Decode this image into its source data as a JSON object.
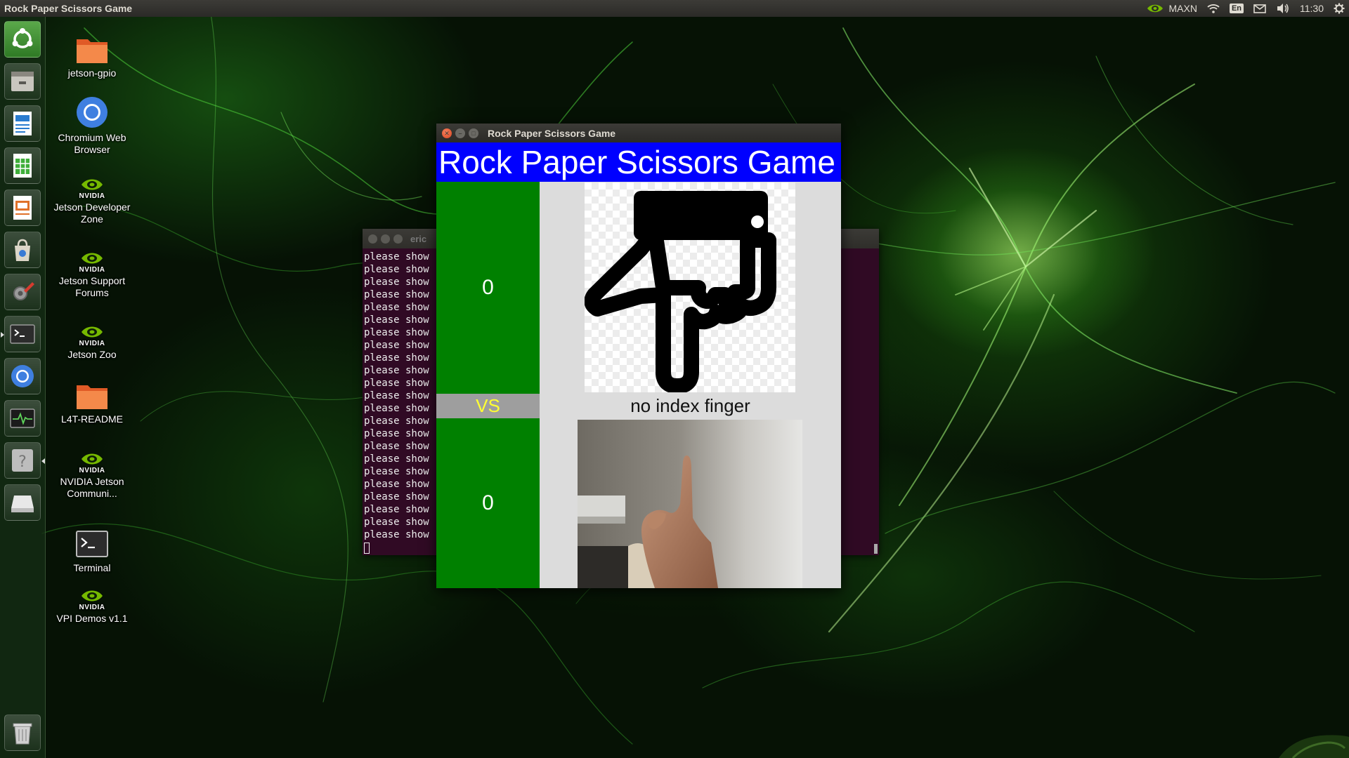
{
  "top_panel": {
    "window_title": "Rock Paper Scissors Game",
    "power_mode": "MAXN",
    "keyboard_layout": "En",
    "clock": "11:30"
  },
  "launcher": {
    "items": [
      {
        "name": "ubuntu-dash-icon"
      },
      {
        "name": "files-icon"
      },
      {
        "name": "libreoffice-writer-icon"
      },
      {
        "name": "libreoffice-calc-icon"
      },
      {
        "name": "libreoffice-impress-icon"
      },
      {
        "name": "software-center-icon"
      },
      {
        "name": "system-settings-icon"
      },
      {
        "name": "terminal-icon"
      },
      {
        "name": "chromium-icon"
      },
      {
        "name": "system-monitor-icon"
      },
      {
        "name": "help-icon"
      },
      {
        "name": "drive-icon"
      },
      {
        "name": "trash-icon"
      }
    ]
  },
  "desktop": {
    "icons": [
      {
        "label": "jetson-gpio",
        "type": "folder"
      },
      {
        "label": "Chromium Web Browser",
        "type": "chromium"
      },
      {
        "label": "Jetson Developer Zone",
        "type": "nvidia"
      },
      {
        "label": "Jetson Support Forums",
        "type": "nvidia"
      },
      {
        "label": "Jetson Zoo",
        "type": "nvidia"
      },
      {
        "label": "L4T-README",
        "type": "folder"
      },
      {
        "label": "NVIDIA Jetson Communi...",
        "type": "nvidia"
      },
      {
        "label": "Terminal",
        "type": "terminal"
      },
      {
        "label": "VPI Demos v1.1",
        "type": "nvidia"
      }
    ],
    "nvidia_logo_text": "NVIDIA"
  },
  "terminal_window": {
    "title": "eric",
    "line_text": "please show",
    "line_count": 23
  },
  "game_window": {
    "title": "Rock Paper Scissors Game",
    "header": "Rock Paper Scissors Game",
    "computer_score": "0",
    "vs_label": "VS",
    "player_score": "0",
    "gesture_label": "no index finger",
    "colors": {
      "header_bg": "#0000ff",
      "score_bg": "#008000",
      "vs_bg": "#9e9e9e",
      "vs_text": "#ffff33"
    }
  }
}
